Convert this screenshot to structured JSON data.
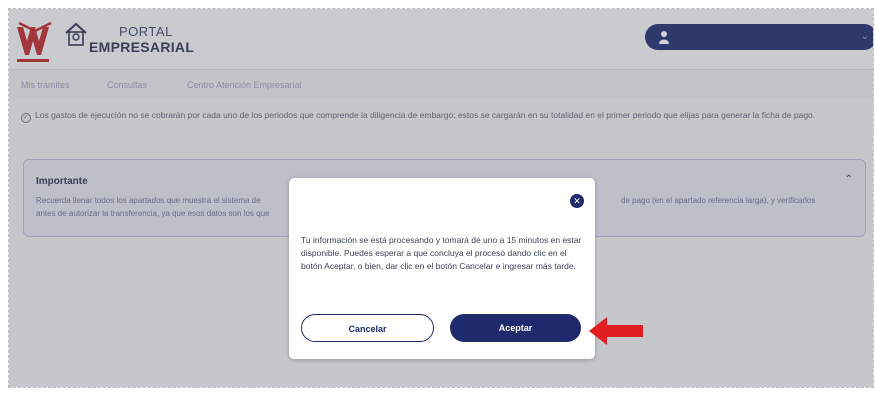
{
  "header": {
    "brand_line1": "PORTAL",
    "brand_line2": "EMPRESARIAL",
    "logo_icon": "infonavit-logo",
    "user_icon": "user-icon",
    "user_menu_chevron": "chevron-down-icon"
  },
  "nav": {
    "items": [
      "Mis trámites",
      "Consultas",
      "Centro Atención Empresarial"
    ]
  },
  "info": {
    "text": "Los gastos de ejecución no se cobrarán por cada uno de los periodos que comprende la diligencia de embargo; estos se cargarán en su totalidad en el primer periodo que elijas para generar la ficha de pago."
  },
  "important": {
    "title": "Importante",
    "line1": "Recuerda llenar todos los apartados que muestra el sistema de",
    "line2": "antes de autorizar la transferencia, ya que esos datos son los que",
    "line1_right": "de pago (en el apartado referencia larga), y verificarlos"
  },
  "modal": {
    "message": "Tu información se está procesando y tomará de uno a 15 minutos en estar disponible. Puedes esperar a que concluya el proceso dando clic en el botón Aceptar, o bien, dar clic en el botón Cancelar e ingresar más tarde.",
    "cancel_label": "Cancelar",
    "accept_label": "Aceptar",
    "close_glyph": "✕"
  },
  "colors": {
    "primary": "#1e2a6b",
    "arrow": "#e02020",
    "logo_red": "#c0262d"
  }
}
